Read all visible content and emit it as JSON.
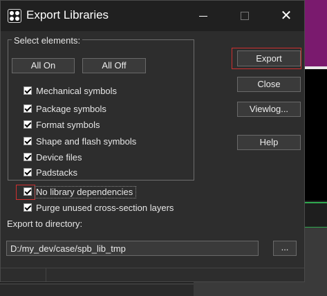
{
  "window": {
    "title": "Export Libraries",
    "minimize_glyph": "",
    "close_glyph": "✕"
  },
  "group": {
    "label": "Select elements:",
    "all_on": "All On",
    "all_off": "All Off",
    "items": [
      {
        "label": "Mechanical symbols",
        "checked": true
      },
      {
        "label": "Package symbols",
        "checked": true
      },
      {
        "label": "Format symbols",
        "checked": true
      },
      {
        "label": "Shape and flash symbols",
        "checked": true
      },
      {
        "label": "Device files",
        "checked": true
      },
      {
        "label": "Padstacks",
        "checked": true
      }
    ]
  },
  "options": {
    "no_library_dependencies": {
      "label": "No library dependencies",
      "checked": true
    },
    "purge_unused": {
      "label": "Purge unused cross-section layers",
      "checked": true
    }
  },
  "buttons": {
    "export": "Export",
    "close": "Close",
    "viewlog": "Viewlog...",
    "help": "Help",
    "browse": "..."
  },
  "directory": {
    "label": "Export to directory:",
    "value": "D:/my_dev/case/spb_lib_tmp"
  },
  "colors": {
    "highlight": "#d03030",
    "dialog_bg": "#2d2d2d",
    "titlebar_bg": "#202020"
  }
}
